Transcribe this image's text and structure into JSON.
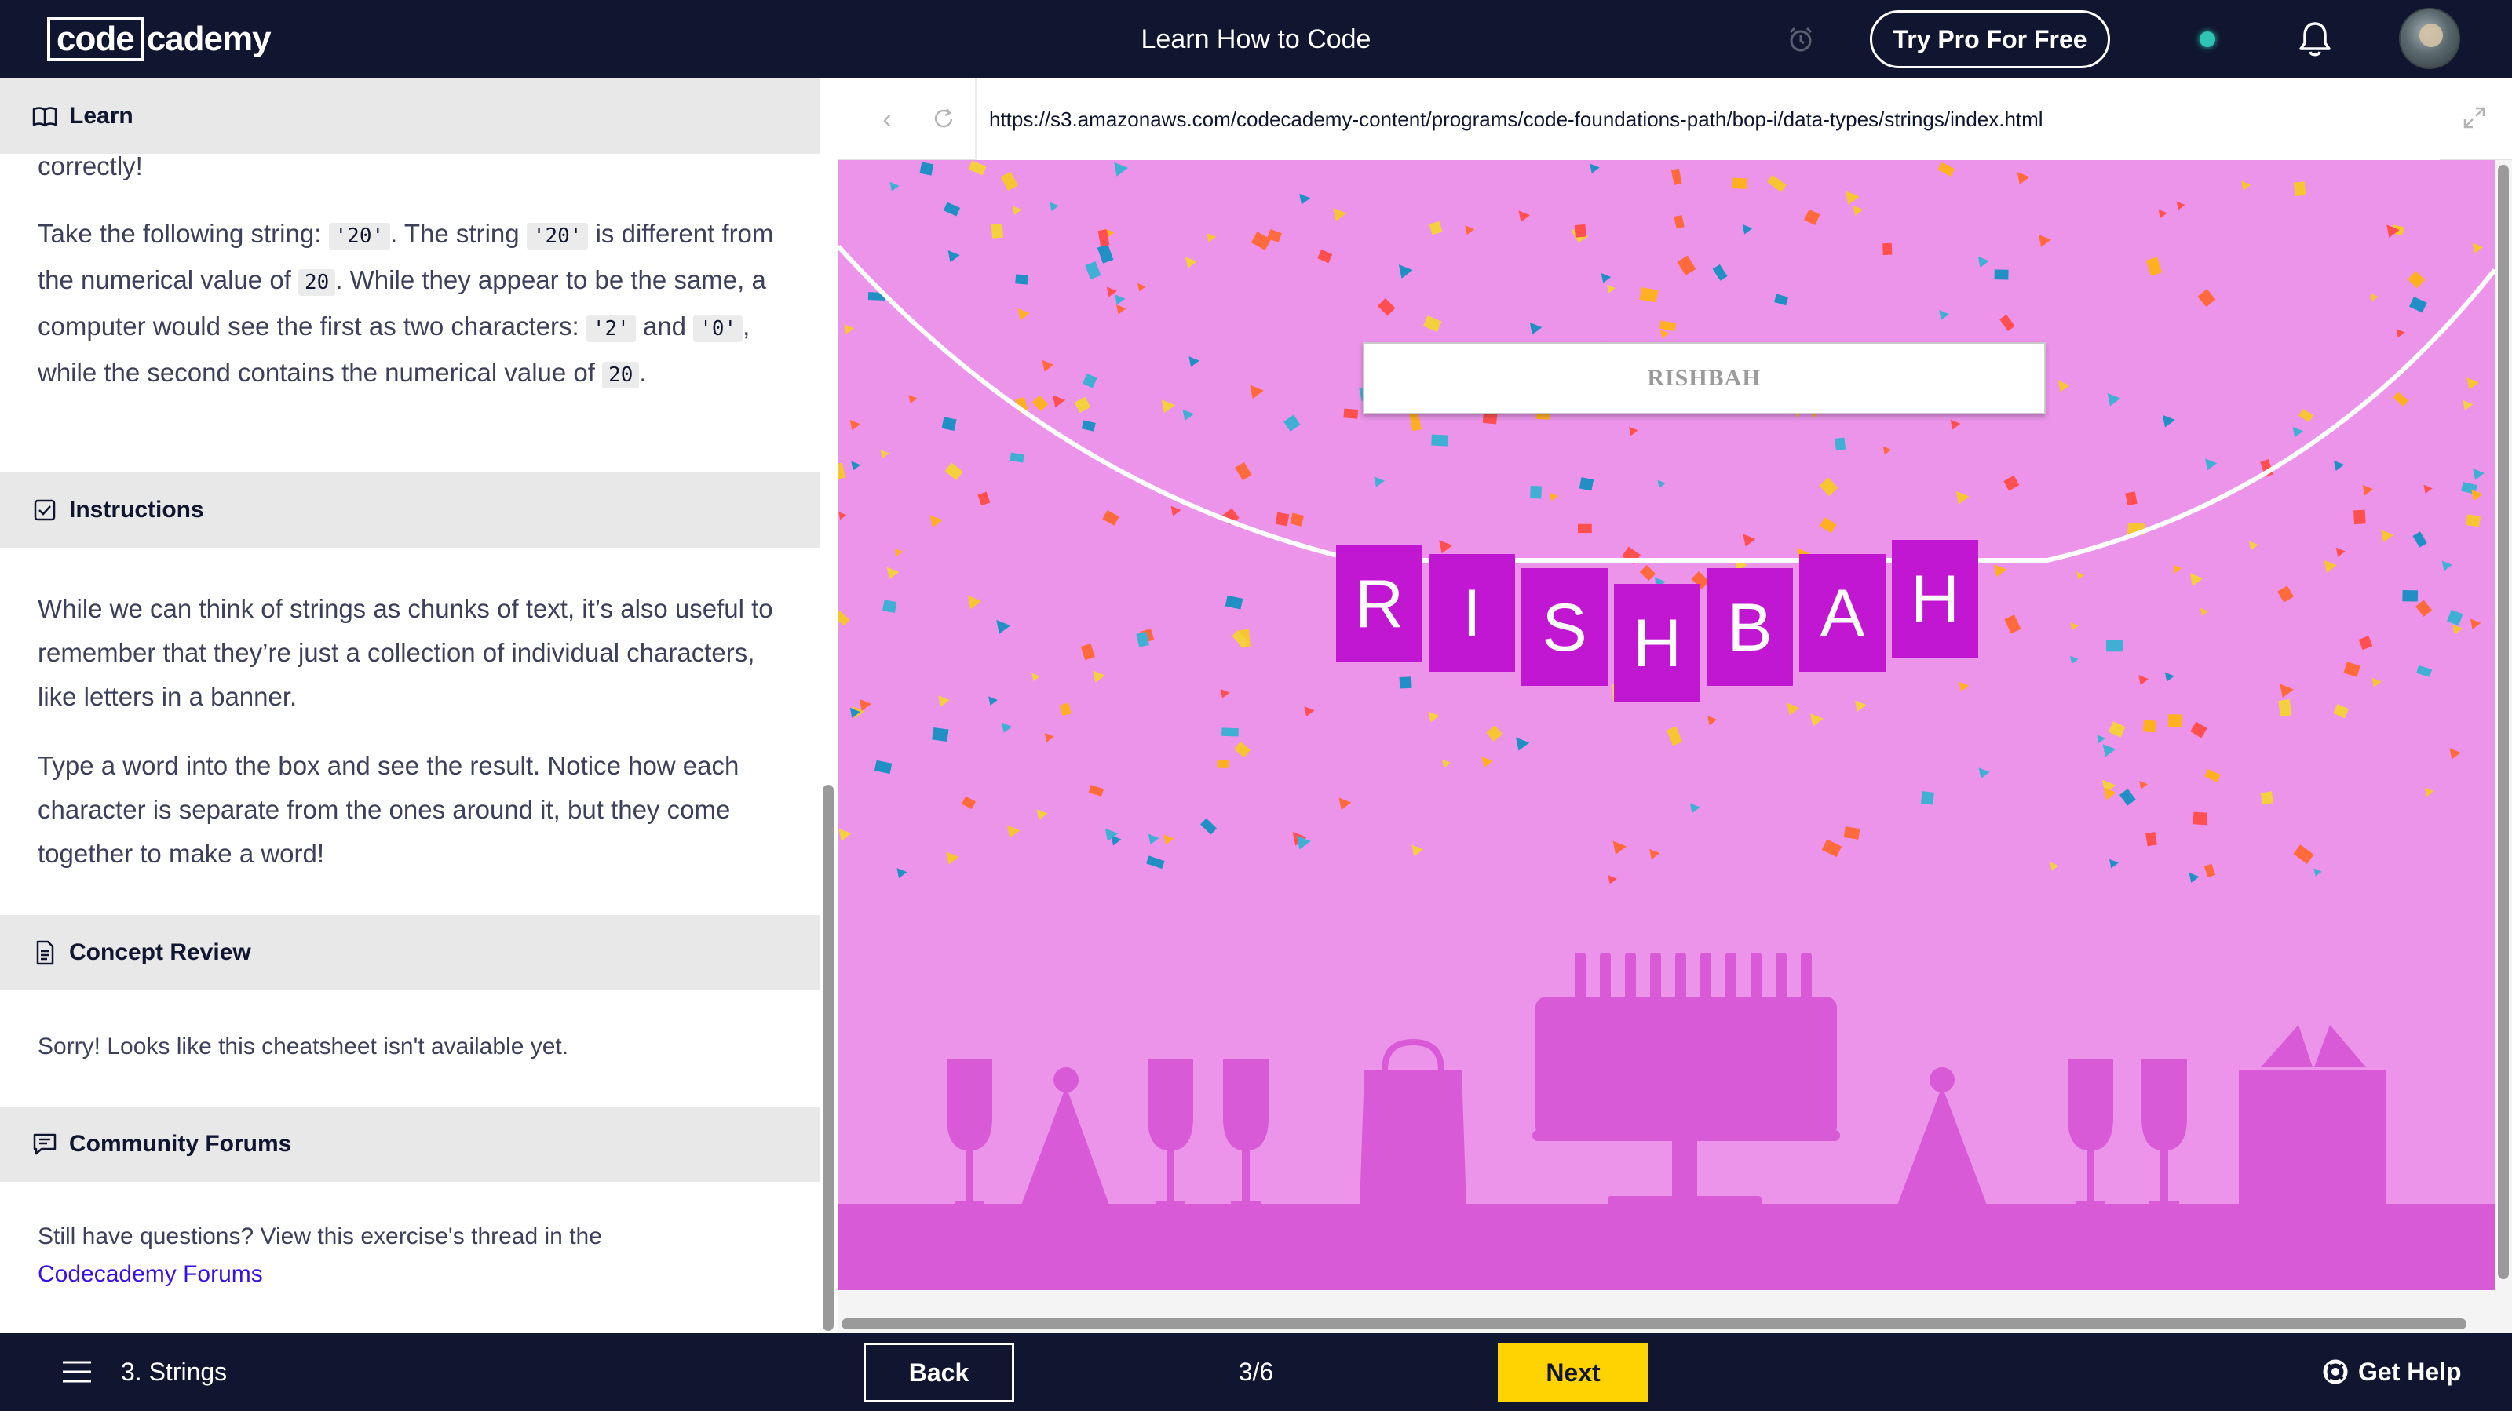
{
  "header": {
    "logo_left": "code",
    "logo_right": "cademy",
    "title": "Learn How to Code",
    "pro_button": "Try Pro For Free"
  },
  "left": {
    "learn": {
      "heading": "Learn",
      "clipped_text": "correctly!",
      "p1_a": "Take the following string: ",
      "p1_code1": "'20'",
      "p1_b": ". The string ",
      "p1_code2": "'20'",
      "p1_c": " is different from the numerical value of ",
      "p1_code3": "20",
      "p1_d": ". While they appear to be the same, a computer would see the first as two characters: ",
      "p1_code4": "'2'",
      "p1_e": " and ",
      "p1_code5": "'0'",
      "p1_f": ", while the second contains the numerical value of ",
      "p1_code6": "20",
      "p1_g": "."
    },
    "instructions": {
      "heading": "Instructions",
      "p1": "While we can think of strings as chunks of text, it’s also useful to remember that they’re just a collection of individual characters, like letters in a banner.",
      "p2": "Type a word into the box and see the result. Notice how each character is separate from the ones around it, but they come together to make a word!"
    },
    "concept": {
      "heading": "Concept Review",
      "text": "Sorry! Looks like this cheatsheet isn't available yet."
    },
    "forums": {
      "heading": "Community Forums",
      "text": "Still have questions? View this exercise's thread in the",
      "link": "Codecademy Forums"
    }
  },
  "browser": {
    "url": "https://s3.amazonaws.com/codecademy-content/programs/code-foundations-path/bop-i/data-types/strings/index.html",
    "input_value": "RISHBAH",
    "banner_letters": [
      "R",
      "I",
      "S",
      "H",
      "B",
      "A",
      "H"
    ]
  },
  "footer": {
    "lesson": "3. Strings",
    "back": "Back",
    "progress": "3/6",
    "next": "Next",
    "help": "Get Help"
  },
  "colors": {
    "nav_bg": "#10162f",
    "preview_bg": "#eb94ea",
    "banner_flag": "#c117d2",
    "silhouette": "#d85ad7",
    "next_button": "#ffd300",
    "link": "#3a10e5"
  },
  "icons": {
    "learn": "book-icon",
    "instructions": "checkbox-icon",
    "concept": "document-icon",
    "forums": "chat-icon",
    "alarm": "alarm-clock-icon",
    "bell": "bell-icon",
    "help": "lifebuoy-icon",
    "menu": "hamburger-icon"
  }
}
